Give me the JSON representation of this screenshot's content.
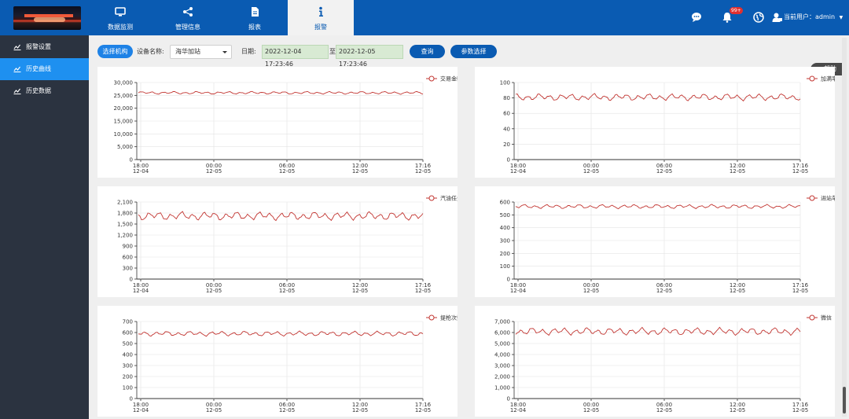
{
  "nav": {
    "tabs": [
      {
        "label": "数据监测",
        "icon": "monitor-icon"
      },
      {
        "label": "管理信息",
        "icon": "share-nodes-icon"
      },
      {
        "label": "报表",
        "icon": "document-icon"
      },
      {
        "label": "报警",
        "icon": "info-icon",
        "active": true
      }
    ],
    "notification_badge": "99+",
    "user_label": "当前用户：admin"
  },
  "sidebar": {
    "items": [
      {
        "label": "报警设置",
        "icon": "line-chart-icon"
      },
      {
        "label": "历史曲线",
        "icon": "line-chart-icon",
        "active": true
      },
      {
        "label": "历史数据",
        "icon": "line-chart-icon"
      }
    ]
  },
  "toolbar": {
    "select_org_label": "选择机构",
    "device_name_label": "设备名称:",
    "device_name_value": "海华加站",
    "date_label": "日期:",
    "date_start": "2022-12-04 17:23:46",
    "date_sep": "至",
    "date_end": "2022-12-05 17:23:46",
    "query_label": "查询",
    "param_label": "参数选择"
  },
  "help_label": "帮助",
  "colors": {
    "series": "#c23531",
    "accent": "#0a5bb2",
    "active_side": "#1e90f0"
  },
  "chart_data": [
    {
      "type": "line",
      "series": [
        {
          "name": "交易金额",
          "mean": 26000,
          "amplitude": 600
        }
      ],
      "ylim": [
        0,
        30000
      ],
      "yticks": [
        "0",
        "5,000",
        "10,000",
        "15,000",
        "20,000",
        "25,000",
        "30,000"
      ],
      "xticks": [
        [
          "18:00",
          "12-04"
        ],
        [
          "00:00",
          "12-05"
        ],
        [
          "06:00",
          "12-05"
        ],
        [
          "12:00",
          "12-05"
        ],
        [
          "17:16",
          "12-05"
        ]
      ]
    },
    {
      "type": "line",
      "series": [
        {
          "name": "加满率",
          "mean": 81,
          "amplitude": 5
        }
      ],
      "ylim": [
        0,
        100
      ],
      "yticks": [
        "0",
        "20",
        "40",
        "60",
        "80",
        "100"
      ],
      "xticks": [
        [
          "18:00",
          "12-04"
        ],
        [
          "00:00",
          "12-05"
        ],
        [
          "06:00",
          "12-05"
        ],
        [
          "12:00",
          "12-05"
        ],
        [
          "17:16",
          "12-05"
        ]
      ]
    },
    {
      "type": "line",
      "series": [
        {
          "name": "汽油任务量",
          "mean": 1720,
          "amplitude": 130
        }
      ],
      "ylim": [
        0,
        2100
      ],
      "yticks": [
        "0",
        "300",
        "600",
        "900",
        "1,200",
        "1,500",
        "1,800",
        "2,100"
      ],
      "xticks": [
        [
          "18:00",
          "12-04"
        ],
        [
          "00:00",
          "12-05"
        ],
        [
          "06:00",
          "12-05"
        ],
        [
          "12:00",
          "12-05"
        ],
        [
          "17:16",
          "12-05"
        ]
      ]
    },
    {
      "type": "line",
      "series": [
        {
          "name": "进站车次",
          "mean": 565,
          "amplitude": 18
        }
      ],
      "ylim": [
        0,
        600
      ],
      "yticks": [
        "0",
        "100",
        "200",
        "300",
        "400",
        "500",
        "600"
      ],
      "xticks": [
        [
          "18:00",
          "12-04"
        ],
        [
          "00:00",
          "12-05"
        ],
        [
          "06:00",
          "12-05"
        ],
        [
          "12:00",
          "12-05"
        ],
        [
          "17:16",
          "12-05"
        ]
      ]
    },
    {
      "type": "line",
      "series": [
        {
          "name": "提枪次数",
          "mean": 590,
          "amplitude": 25
        }
      ],
      "ylim": [
        0,
        700
      ],
      "yticks": [
        "0",
        "100",
        "200",
        "300",
        "400",
        "500",
        "600",
        "700"
      ],
      "xticks": [
        [
          "18:00",
          "12-04"
        ],
        [
          "00:00",
          "12-05"
        ],
        [
          "06:00",
          "12-05"
        ],
        [
          "12:00",
          "12-05"
        ],
        [
          "17:16",
          "12-05"
        ]
      ]
    },
    {
      "type": "line",
      "series": [
        {
          "name": "微信",
          "mean": 6100,
          "amplitude": 380
        }
      ],
      "ylim": [
        0,
        7000
      ],
      "yticks": [
        "0",
        "1,000",
        "2,000",
        "3,000",
        "4,000",
        "5,000",
        "6,000",
        "7,000"
      ],
      "xticks": [
        [
          "18:00",
          "12-04"
        ],
        [
          "00:00",
          "12-05"
        ],
        [
          "06:00",
          "12-05"
        ],
        [
          "12:00",
          "12-05"
        ],
        [
          "17:16",
          "12-05"
        ]
      ]
    }
  ]
}
